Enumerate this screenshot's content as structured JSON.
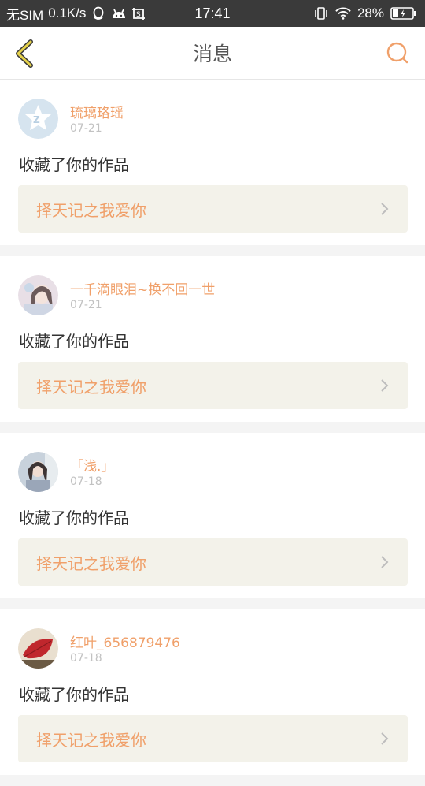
{
  "status_bar": {
    "carrier": "无SIM",
    "speed": "0.1K/s",
    "time": "17:41",
    "battery": "28%",
    "icons_left": [
      "qq-icon",
      "android-icon",
      "screenshot-icon"
    ],
    "icons_right": [
      "vibrate-icon",
      "wifi-icon",
      "battery-charging-icon"
    ]
  },
  "header": {
    "title": "消息",
    "back_icon": "chevron-left-icon",
    "search_icon": "search-icon"
  },
  "colors": {
    "accent": "#f0a06a",
    "back_arrow": "#d8c23a",
    "card_link_bg": "#f3f2ea",
    "status_bar_bg": "#3a3a3a"
  },
  "messages": [
    {
      "username": "琉璃珞瑶",
      "date": "07-21",
      "action": "收藏了你的作品",
      "work_title": "择天记之我爱你",
      "avatar": "qzone-default-avatar"
    },
    {
      "username": "一千滴眼泪~换不回一世",
      "date": "07-21",
      "action": "收藏了你的作品",
      "work_title": "择天记之我爱你",
      "avatar": "girl-photo-avatar"
    },
    {
      "username": "「浅.」",
      "date": "07-18",
      "action": "收藏了你的作品",
      "work_title": "择天记之我爱你",
      "avatar": "girl-photo-avatar"
    },
    {
      "username": "红叶_656879476",
      "date": "07-18",
      "action": "收藏了你的作品",
      "work_title": "择天记之我爱你",
      "avatar": "red-leaf-avatar"
    }
  ]
}
